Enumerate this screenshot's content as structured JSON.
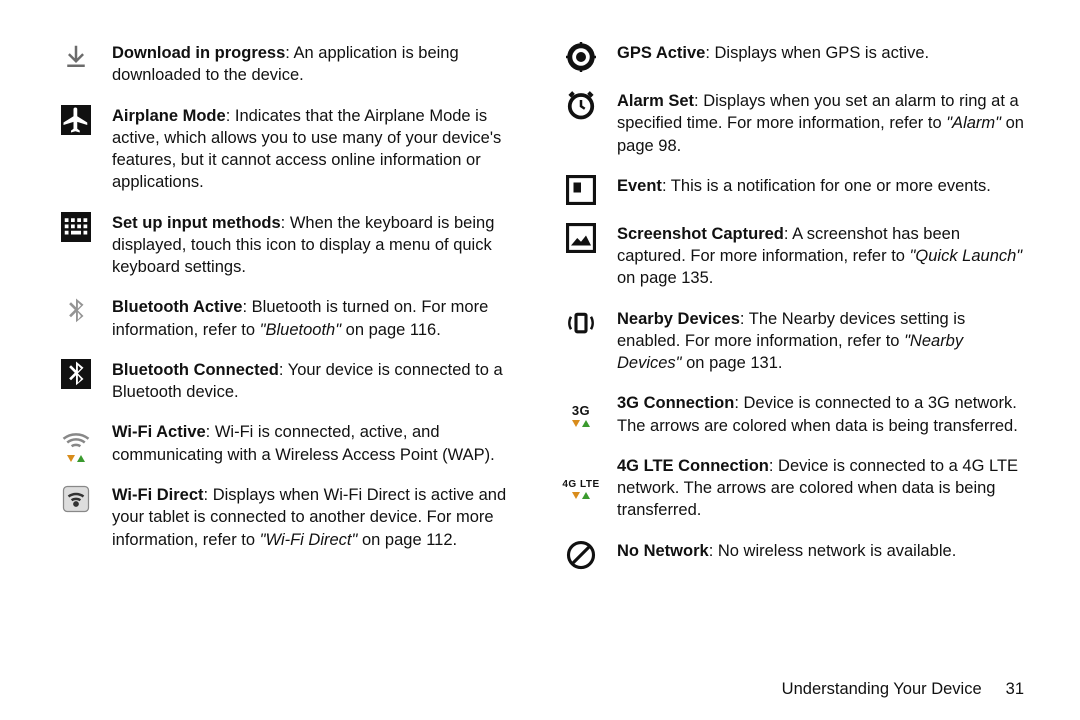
{
  "footer": {
    "section": "Understanding Your Device",
    "page": "31"
  },
  "left": [
    {
      "title": "Download in progress",
      "body": ": An application is being downloaded to the device."
    },
    {
      "title": "Airplane Mode",
      "body": ": Indicates that the Airplane Mode is active, which allows you to use many of your device's features, but it cannot access online information or applications."
    },
    {
      "title": "Set up input methods",
      "body": ": When the keyboard is being displayed, touch this icon to display a menu of quick keyboard settings."
    },
    {
      "title": "Bluetooth Active",
      "body": ": Bluetooth is turned on. For more information, refer to ",
      "ref": "\"Bluetooth\"",
      "tail": " on page 116."
    },
    {
      "title": "Bluetooth Connected",
      "body": ": Your device is connected to a Bluetooth device."
    },
    {
      "title": "Wi-Fi Active",
      "body": ": Wi-Fi is connected, active, and communicating with a Wireless Access Point (WAP)."
    },
    {
      "title": "Wi-Fi Direct",
      "body": ": Displays when Wi-Fi Direct is active and your tablet is connected to another device. For more information, refer to ",
      "ref": "\"Wi-Fi Direct\"",
      "tail": " on page 112."
    }
  ],
  "right": [
    {
      "title": "GPS Active",
      "body": ": Displays when GPS is active."
    },
    {
      "title": "Alarm Set",
      "body": ": Displays when you set an alarm to ring at a specified time. For more information, refer to ",
      "ref": "\"Alarm\"",
      "tail": " on page 98."
    },
    {
      "title": "Event",
      "body": ": This is a notification for one or more events."
    },
    {
      "title": "Screenshot Captured",
      "body": ": A screenshot has been captured. For more information, refer to ",
      "ref": "\"Quick Launch\"",
      "tail": " on page 135."
    },
    {
      "title": "Nearby Devices",
      "body": ": The Nearby devices setting is enabled. For more information, refer to ",
      "ref": "\"Nearby Devices\"",
      "tail": " on page 131."
    },
    {
      "title": "3G Connection",
      "body": ": Device is connected to a 3G network. The arrows are colored when data is being transferred."
    },
    {
      "title": "4G LTE Connection",
      "body": ": Device is connected to a 4G LTE network. The arrows are colored when data is being transferred."
    },
    {
      "title": "No Network",
      "body": ": No wireless network is available."
    }
  ],
  "g3": "3G",
  "g4": "4G LTE"
}
